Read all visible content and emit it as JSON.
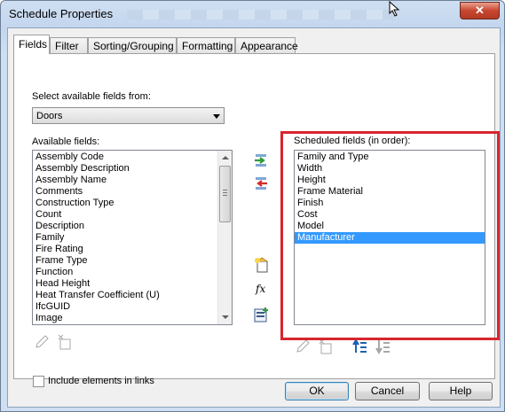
{
  "window": {
    "title": "Schedule Properties",
    "close_label": "✕"
  },
  "tabs": [
    "Fields",
    "Filter",
    "Sorting/Grouping",
    "Formatting",
    "Appearance"
  ],
  "fields": {
    "select_from_label": "Select available fields from:",
    "category_value": "Doors",
    "available_label": "Available fields:",
    "available": [
      "Assembly Code",
      "Assembly Description",
      "Assembly Name",
      "Comments",
      "Construction Type",
      "Count",
      "Description",
      "Family",
      "Fire Rating",
      "Frame Type",
      "Function",
      "Head Height",
      "Heat Transfer Coefficient (U)",
      "IfcGUID",
      "Image"
    ],
    "scheduled_label": "Scheduled fields (in order):",
    "scheduled": [
      "Family and Type",
      "Width",
      "Height",
      "Frame Material",
      "Finish",
      "Cost",
      "Model",
      "Manufacturer"
    ],
    "scheduled_selected_index": 7,
    "include_links_label": "Include elements in links",
    "fx_label": "fx"
  },
  "buttons": {
    "ok": "OK",
    "cancel": "Cancel",
    "help": "Help"
  },
  "colors": {
    "selection": "#3399ff",
    "highlight_box": "#d8252f",
    "add_arrow": "#2e9b3a",
    "remove_arrow": "#d62b2b"
  }
}
